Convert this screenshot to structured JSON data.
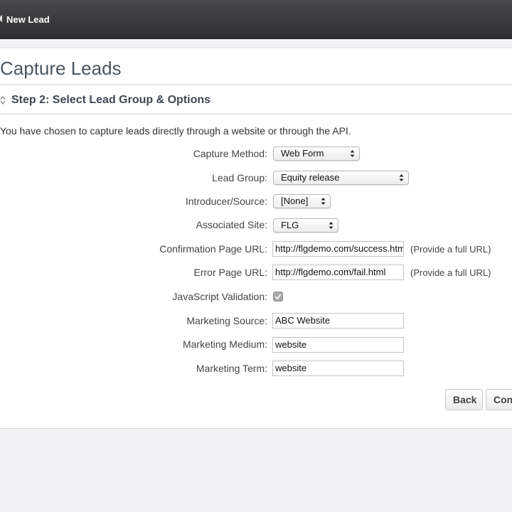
{
  "header": {
    "title": "New Lead"
  },
  "page": {
    "title": "Capture Leads",
    "step_title": "Step 2: Select Lead Group & Options",
    "intro": "You have chosen to capture leads directly through a website or through the API."
  },
  "form": {
    "capture_method": {
      "label": "Capture Method:",
      "value": "Web Form"
    },
    "lead_group": {
      "label": "Lead Group:",
      "value": "Equity release"
    },
    "introducer": {
      "label": "Introducer/Source:",
      "value": "[None]"
    },
    "associated_site": {
      "label": "Associated Site:",
      "value": "FLG"
    },
    "confirmation_url": {
      "label": "Confirmation Page URL:",
      "value": "http://flgdemo.com/success.html",
      "hint": "(Provide a full URL)"
    },
    "error_url": {
      "label": "Error Page URL:",
      "value": "http://flgdemo.com/fail.html",
      "hint": "(Provide a full URL)"
    },
    "js_validation": {
      "label": "JavaScript Validation:",
      "checked": true
    },
    "marketing_source": {
      "label": "Marketing Source:",
      "value": "ABC Website"
    },
    "marketing_medium": {
      "label": "Marketing Medium:",
      "value": "website"
    },
    "marketing_term": {
      "label": "Marketing Term:",
      "value": "website"
    }
  },
  "buttons": {
    "back": "Back",
    "continue": "Continue"
  },
  "icons": {
    "step": "collapse-arrows-icon",
    "select": "select-arrows-icon",
    "check": "checkmark-icon",
    "back": "back-arrow-icon"
  },
  "colors": {
    "topbar": "#3a3a3c",
    "title": "#4a5563",
    "background": "#f2f2f4"
  }
}
